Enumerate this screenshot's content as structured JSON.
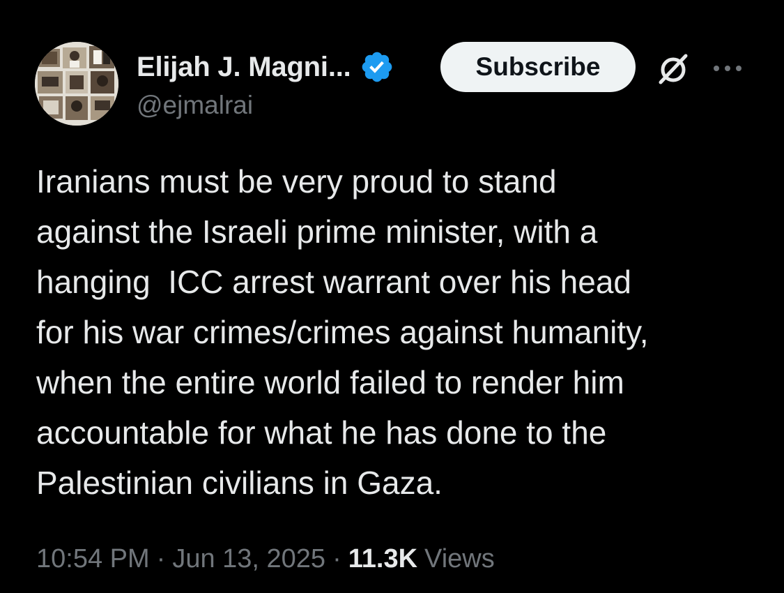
{
  "author": {
    "display_name": "Elijah J. Magni...",
    "handle": "@ejmalrai",
    "verified_color": "#1d9bf0",
    "avatar_icon": "collage-photo-avatar"
  },
  "actions": {
    "subscribe_label": "Subscribe",
    "grok_icon": "grok-icon",
    "more_icon": "more-icon"
  },
  "tweet": {
    "text": "Iranians must be very proud to stand\nagainst the Israeli prime minister, with a\nhanging  ICC arrest warrant over his head\nfor his war crimes/crimes against humanity,\nwhen the entire world failed to render him\naccountable for what he has done to the\nPalestinian civilians in Gaza."
  },
  "meta": {
    "time": "10:54 PM",
    "separator": "·",
    "date": "Jun 13, 2025",
    "views_count": "11.3K",
    "views_label": "Views"
  },
  "colors": {
    "background": "#000000",
    "text_primary": "#e7e9ea",
    "text_secondary": "#71767b",
    "button_bg": "#eff3f4",
    "button_text": "#0f1419"
  }
}
